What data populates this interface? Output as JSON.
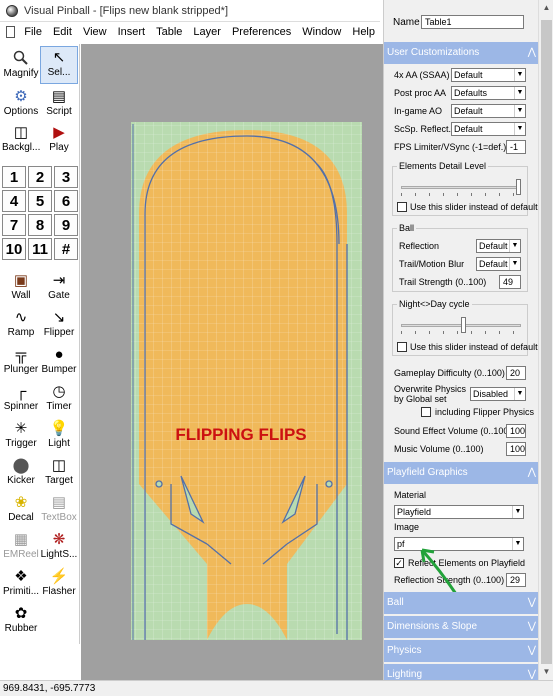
{
  "window": {
    "title": "Visual Pinball - [Flips new blank stripped*]"
  },
  "menu": [
    "File",
    "Edit",
    "View",
    "Insert",
    "Table",
    "Layer",
    "Preferences",
    "Window",
    "Help"
  ],
  "toolbox": {
    "magnify": "Magnify",
    "select": "Sel...",
    "options": "Options",
    "script": "Script",
    "backglass": "Backgl...",
    "play": "Play",
    "layers": [
      "1",
      "2",
      "3",
      "4",
      "5",
      "6",
      "7",
      "8",
      "9",
      "10",
      "11",
      "#"
    ],
    "items": [
      "Wall",
      "Gate",
      "Ramp",
      "Flipper",
      "Plunger",
      "Bumper",
      "Spinner",
      "Timer",
      "Trigger",
      "Light",
      "Kicker",
      "Target",
      "Decal",
      "TextBox",
      "EMReel",
      "LightS...",
      "Primiti...",
      "Flasher",
      "Rubber"
    ]
  },
  "canvas": {
    "table_text": "FLIPPING FLIPS"
  },
  "status": {
    "coords": "969.8431, -695.7773"
  },
  "props": {
    "name_label": "Name",
    "name_value": "Table1",
    "user_cust": "User Customizations",
    "aa_label": "4x AA (SSAA)",
    "aa_value": "Default",
    "pp_label": "Post proc AA",
    "pp_value": "Defaults",
    "ao_label": "In-game AO",
    "ao_value": "Default",
    "ssr_label": "ScSp. Reflect.",
    "ssr_value": "Default",
    "fps_label": "FPS Limiter/VSync (-1=def.)",
    "fps_value": "-1",
    "edl_group": "Elements Detail Level",
    "edl_check": "Use this slider instead of default",
    "ball_group": "Ball",
    "refl_label": "Reflection",
    "refl_value": "Default",
    "trail_label": "Trail/Motion Blur",
    "trail_value": "Default",
    "trails_label": "Trail Strength (0..100)",
    "trails_value": "49",
    "nd_group": "Night<>Day cycle",
    "nd_check": "Use this slider instead of default",
    "diff_label": "Gameplay Difficulty (0..100)",
    "diff_value": "20",
    "ovr_label": "Overwrite Physics by Global set",
    "ovr_value": "Disabled",
    "incl_label": "including Flipper Physics",
    "sfx_label": "Sound Effect Volume (0..100)",
    "sfx_value": "100",
    "mus_label": "Music Volume (0..100)",
    "mus_value": "100",
    "pf_graphics": "Playfield Graphics",
    "mat_label": "Material",
    "mat_value": "Playfield",
    "img_label": "Image",
    "img_value": "pf",
    "rb_label": "Reflect Elements on Playfield",
    "rs_label": "Reflection Strength (0..100)",
    "rs_value": "29",
    "sec_ball": "Ball",
    "sec_dim": "Dimensions & Slope",
    "sec_phys": "Physics",
    "sec_light": "Lighting"
  },
  "colors": {
    "section_header": "#9cb7e6",
    "playfield": "#f0b95a",
    "apron": "#b9dbb0",
    "title_red": "#cc1111",
    "arrow": "#22a23a"
  }
}
